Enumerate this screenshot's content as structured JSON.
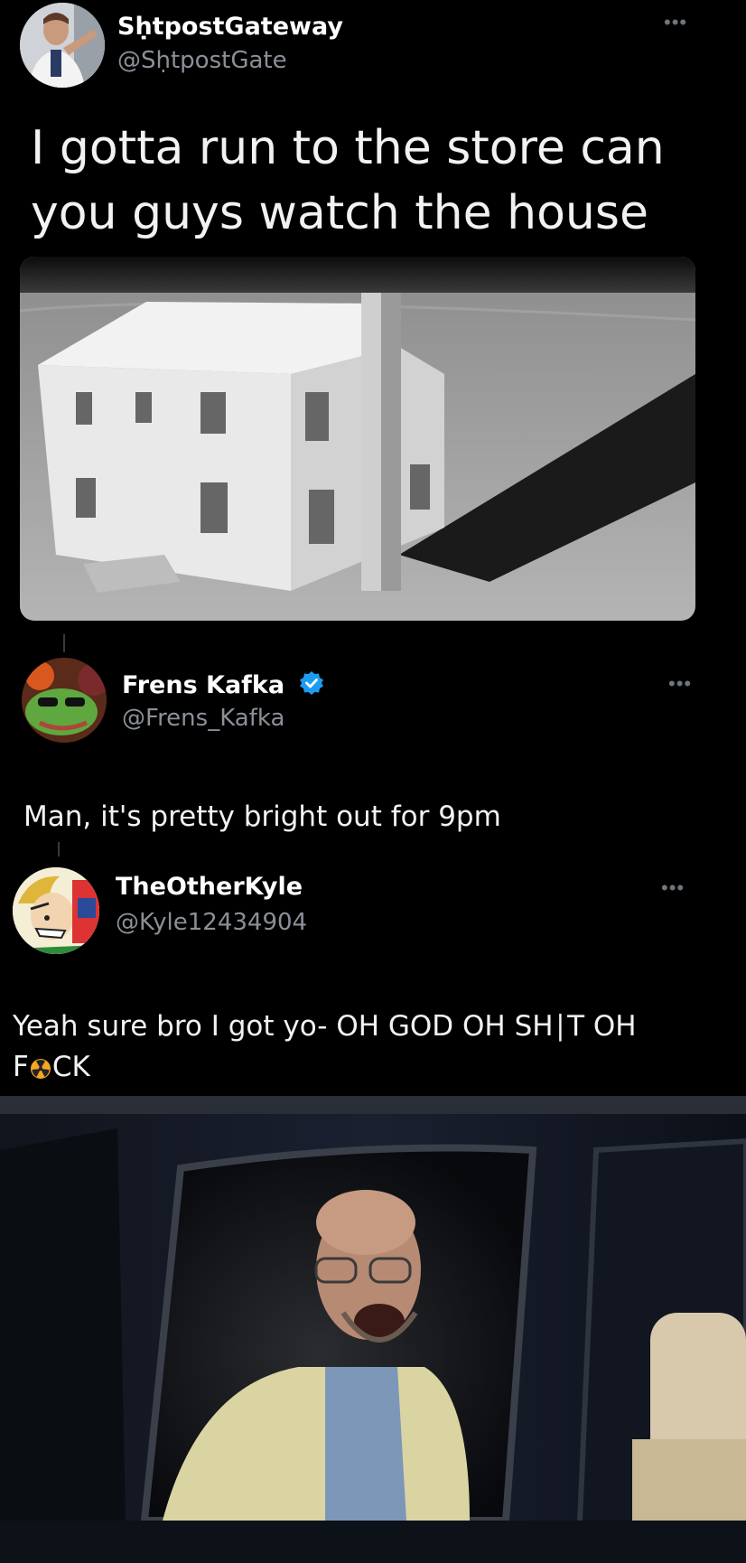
{
  "tweet1": {
    "display_name": "SḥtpostGateway",
    "handle": "@SḥtpostGate",
    "text": "I gotta run to the store can you guys watch the house"
  },
  "tweet2": {
    "display_name": "Frens Kafka",
    "handle": "@Frens_Kafka",
    "verified": true,
    "text": "Man, it's pretty bright out for 9pm"
  },
  "tweet3": {
    "display_name": "TheOtherKyle",
    "handle": "@Kyle12434904",
    "text_line1": "Yeah sure bro I got yo- OH GOD OH SH∣T OH",
    "text_line2_prefix": "F",
    "text_line2_suffix": "CK"
  },
  "icons": {
    "more": "more-horizontal-icon",
    "verified": "verified-badge-icon",
    "nuclear": "radiation-emoji-icon"
  },
  "colors": {
    "background": "#000000",
    "handle_gray": "#8b9098",
    "verified_blue": "#1d9bf0"
  }
}
